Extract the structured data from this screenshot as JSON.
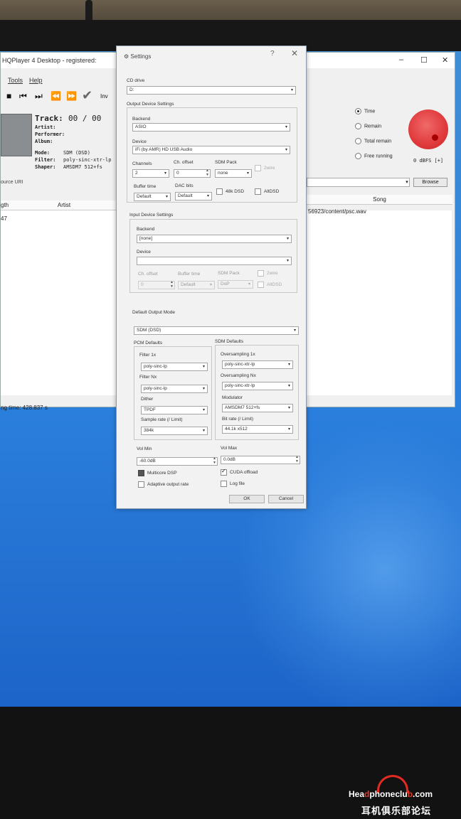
{
  "main_window": {
    "title": "HQPlayer 4 Desktop - registered:",
    "menu": [
      "Tools",
      "Help"
    ],
    "toolbar": {
      "inv_label": "Inv"
    },
    "now_playing": {
      "track_label": "Track:",
      "track_value": "00 / 00",
      "fields": [
        {
          "label": "Artist:",
          "value": ""
        },
        {
          "label": "Performer:",
          "value": ""
        },
        {
          "label": "Album:",
          "value": ""
        },
        {
          "label": "Mode:",
          "value": "SDM (DSD)"
        },
        {
          "label": "Filter:",
          "value": "poly-sinc-xtr-lp"
        },
        {
          "label": "Shaper:",
          "value": "AMSDM7 512+fs"
        }
      ]
    },
    "time_options": [
      {
        "label": "Time",
        "selected": true
      },
      {
        "label": "Remain",
        "selected": false
      },
      {
        "label": "Total remain",
        "selected": false
      },
      {
        "label": "Free running",
        "selected": false
      }
    ],
    "volume_readout": "0 dBFS [+]",
    "source_label": "ource URI",
    "browse_label": "Browse",
    "columns": [
      "gth",
      "Artist",
      "Song"
    ],
    "row": {
      "length": "47",
      "song": "56923/content/psc.wav"
    },
    "status": "ng time: 428.837 s"
  },
  "settings": {
    "title": "Settings",
    "help": "?",
    "close": "✕",
    "cd_drive": {
      "label": "CD drive",
      "value": "D:"
    },
    "output": {
      "group_label": "Output Device Settings",
      "backend_label": "Backend",
      "backend_value": "ASIO",
      "device_label": "Device",
      "device_value": "iFi (by AMR) HD USB Audio",
      "channels_label": "Channels",
      "channels_value": "2",
      "ch_offset_label": "Ch. offset",
      "ch_offset_value": "0",
      "sdm_pack_label": "SDM Pack",
      "sdm_pack_value": "none",
      "wire2_label": "2wire",
      "buffer_time_label": "Buffer time",
      "buffer_time_value": "Default",
      "dac_bits_label": "DAC bits",
      "dac_bits_value": "Default",
      "bsd48k_label": "48k DSD",
      "altdsd_label": "AltDSD"
    },
    "input": {
      "group_label": "Input Device Settings",
      "backend_label": "Backend",
      "backend_value": "[none]",
      "device_label": "Device",
      "device_value": "",
      "ch_offset_label": "Ch. offset",
      "ch_offset_value": "0",
      "buffer_time_label": "Buffer time",
      "buffer_time_value": "Default",
      "sdm_pack_label": "SDM Pack",
      "sdm_pack_value": "DoP",
      "wire2_label": "2wire",
      "altdsd_label": "AltDSD"
    },
    "default_output_mode": {
      "label": "Default Output Mode",
      "value": "SDM (DSD)"
    },
    "pcm": {
      "group_label": "PCM Defaults",
      "filter1x_label": "Filter 1x",
      "filter1x_value": "poly-sinc-lp",
      "filternx_label": "Filter Nx",
      "filternx_value": "poly-sinc-lp",
      "dither_label": "Dither",
      "dither_value": "TPDF",
      "sample_rate_label": "Sample rate (/ Limit)",
      "sample_rate_value": "384k"
    },
    "sdm": {
      "group_label": "SDM Defaults",
      "os1x_label": "Oversampling 1x",
      "os1x_value": "poly-sinc-xtr-lp",
      "osnx_label": "Oversampling Nx",
      "osnx_value": "poly-sinc-xtr-lp",
      "modulator_label": "Modulator",
      "modulator_value": "AMSDM7 512+fs",
      "bit_rate_label": "Bit rate (/ Limit)",
      "bit_rate_value": "44.1k x512"
    },
    "vol_min": {
      "label": "Vol Min",
      "value": "-60.0dB"
    },
    "vol_max": {
      "label": "Vol Max",
      "value": "0.0dB"
    },
    "multicore_label": "Multicore DSP",
    "cuda_label": "CUDA offload",
    "adaptive_label": "Adaptive output rate",
    "logfile_label": "Log file",
    "ok_label": "OK",
    "cancel_label": "Cancel"
  },
  "watermark": {
    "brand_a": "Hea",
    "brand_b": "phoneclu",
    "brand_c": ".com",
    "cn": "耳机俱乐部论坛"
  }
}
